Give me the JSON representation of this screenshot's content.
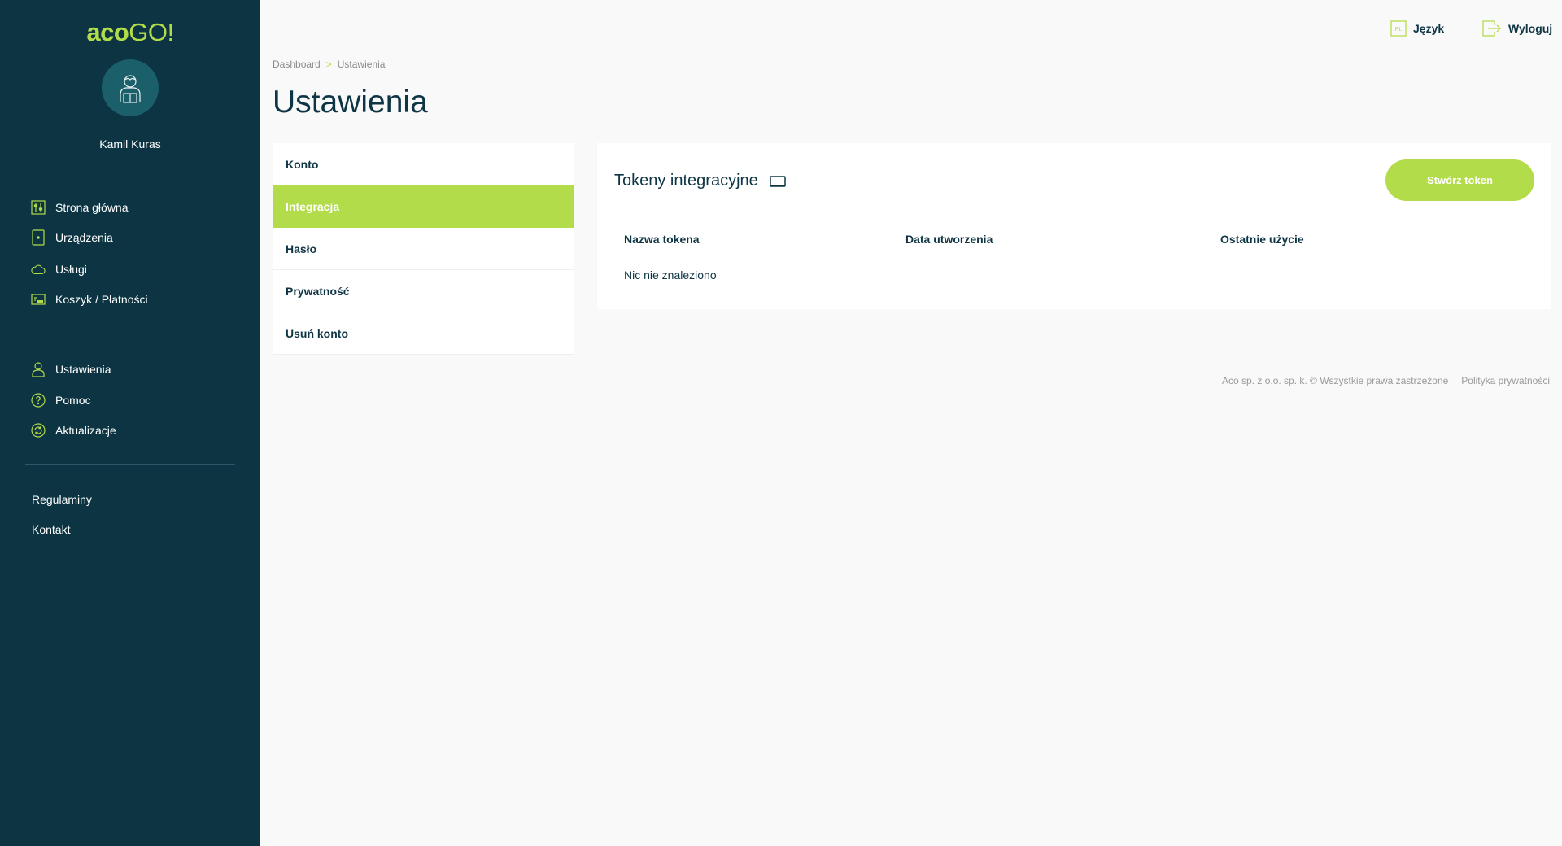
{
  "brand": {
    "part1": "aco",
    "part2": "GO!",
    "accent": "#b3dc4a",
    "sidebar_bg": "#0c3443"
  },
  "user": {
    "name": "Kamil Kuras"
  },
  "sidebar": {
    "main": [
      {
        "label": "Strona główna",
        "icon": "dashboard-icon"
      },
      {
        "label": "Urządzenia",
        "icon": "device-icon"
      },
      {
        "label": "Usługi",
        "icon": "cloud-icon"
      },
      {
        "label": "Koszyk / Płatności",
        "icon": "payment-icon"
      }
    ],
    "secondary": [
      {
        "label": "Ustawienia",
        "icon": "user-settings-icon"
      },
      {
        "label": "Pomoc",
        "icon": "help-icon"
      },
      {
        "label": "Aktualizacje",
        "icon": "refresh-icon"
      }
    ],
    "links": [
      "Regulaminy",
      "Kontakt"
    ]
  },
  "topbar": {
    "language_label": "Język",
    "language_code": "PL",
    "logout_label": "Wyloguj"
  },
  "breadcrumb": {
    "items": [
      "Dashboard",
      "Ustawienia"
    ],
    "separator": ">"
  },
  "page": {
    "title": "Ustawienia"
  },
  "settings_menu": {
    "active_index": 1,
    "items": [
      "Konto",
      "Integracja",
      "Hasło",
      "Prywatność",
      "Usuń konto"
    ]
  },
  "panel": {
    "title": "Tokeny integracyjne",
    "create_button": "Stwórz token",
    "columns": [
      "Nazwa tokena",
      "Data utworzenia",
      "Ostatnie użycie"
    ],
    "empty_text": "Nic nie znaleziono"
  },
  "footer": {
    "copyright": "Aco sp. z o.o. sp. k. © Wszystkie prawa zastrzeżone",
    "privacy": "Polityka prywatności"
  }
}
